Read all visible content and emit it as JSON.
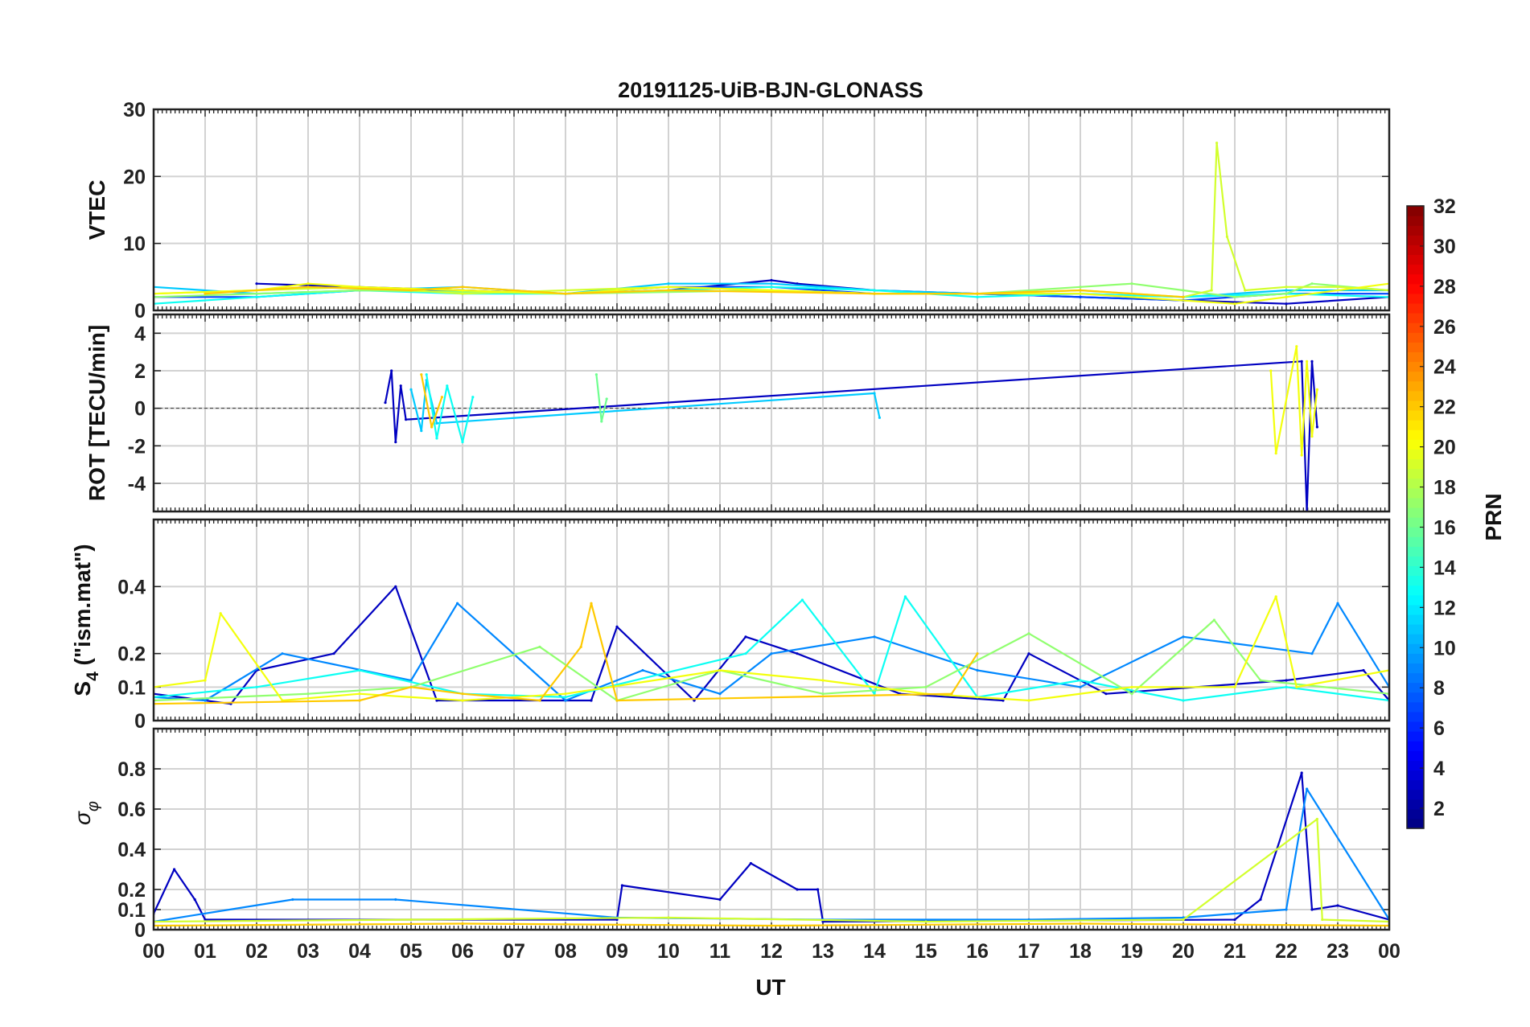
{
  "chart_data": {
    "type": "line",
    "title": "20191125-UiB-BJN-GLONASS",
    "xlabel": "UT",
    "x_unit": "hour",
    "xlim": [
      0,
      24
    ],
    "x_tick_values": [
      0,
      1,
      2,
      3,
      4,
      5,
      6,
      7,
      8,
      9,
      10,
      11,
      12,
      13,
      14,
      15,
      16,
      17,
      18,
      19,
      20,
      21,
      22,
      23,
      24
    ],
    "x_tick_labels": [
      "00",
      "01",
      "02",
      "03",
      "04",
      "05",
      "06",
      "07",
      "08",
      "09",
      "10",
      "11",
      "12",
      "13",
      "14",
      "15",
      "16",
      "17",
      "18",
      "19",
      "20",
      "21",
      "22",
      "23",
      "00"
    ],
    "grid": true,
    "colorbar": {
      "label": "PRN",
      "range": [
        1,
        32
      ],
      "colormap": "jet",
      "tick_labels": [
        "2",
        "4",
        "6",
        "8",
        "10",
        "12",
        "14",
        "16",
        "18",
        "20",
        "22",
        "24",
        "26",
        "28",
        "30",
        "32"
      ]
    },
    "panels": [
      {
        "ylabel": "VTEC",
        "ylim": [
          0,
          30
        ],
        "yticks": [
          "0",
          "10",
          "20",
          "30"
        ],
        "series": [
          {
            "prn": 3,
            "x": [
              2.0,
              4.0,
              6.0,
              8.0,
              10.0,
              12.0,
              12.5,
              14.0,
              16.0,
              18.0,
              20.0,
              22.0,
              24.0
            ],
            "y": [
              4.0,
              3.5,
              3.0,
              2.5,
              3.0,
              4.5,
              4.0,
              3.0,
              2.5,
              2.0,
              1.5,
              1.0,
              2.0
            ]
          },
          {
            "prn": 7,
            "x": [
              0.0,
              2.0,
              4.0,
              6.0,
              8.0,
              10.0,
              12.0,
              14.0,
              16.0,
              18.0,
              20.0,
              22.0,
              24.0
            ],
            "y": [
              2.0,
              2.0,
              3.0,
              3.0,
              2.5,
              3.5,
              3.5,
              2.5,
              2.5,
              2.0,
              1.5,
              2.5,
              2.5
            ]
          },
          {
            "prn": 11,
            "x": [
              0.0,
              2.0,
              4.0,
              6.0,
              8.0,
              10.0,
              12.0,
              14.0,
              16.0,
              18.0,
              20.0,
              22.0,
              24.0
            ],
            "y": [
              3.5,
              2.5,
              3.0,
              3.5,
              2.5,
              4.0,
              4.0,
              3.0,
              2.5,
              2.5,
              2.0,
              3.0,
              3.0
            ]
          },
          {
            "prn": 13,
            "x": [
              0.0,
              2.0,
              4.0,
              6.0,
              8.0,
              10.0,
              12.0,
              14.0,
              16.0,
              18.0,
              20.0,
              22.0,
              24.0
            ],
            "y": [
              1.0,
              2.0,
              3.0,
              2.5,
              2.5,
              3.0,
              3.5,
              3.0,
              2.0,
              2.5,
              2.0,
              2.5,
              2.0
            ]
          },
          {
            "prn": 17,
            "x": [
              0.0,
              4.0,
              8.0,
              12.0,
              14.0,
              16.0,
              18.0,
              19.0,
              20.0,
              21.0,
              22.0,
              22.5,
              24.0
            ],
            "y": [
              2.0,
              3.0,
              2.5,
              3.0,
              2.5,
              2.5,
              3.5,
              4.0,
              3.0,
              2.0,
              2.5,
              4.0,
              3.0
            ]
          },
          {
            "prn": 19,
            "x": [
              0.0,
              2.0,
              4.0,
              6.0,
              8.0,
              10.0,
              12.0,
              14.0,
              16.0,
              18.0,
              20.0,
              20.55,
              20.65,
              20.85,
              21.2,
              22.0,
              23.0,
              24.0
            ],
            "y": [
              2.5,
              3.0,
              3.5,
              2.5,
              3.0,
              3.5,
              3.0,
              2.5,
              2.5,
              3.0,
              2.0,
              3.0,
              25.0,
              11.0,
              3.0,
              3.5,
              3.5,
              3.0
            ]
          },
          {
            "prn": 20,
            "x": [
              0.0,
              2.0,
              3.0,
              4.0,
              6.0,
              8.0,
              10.0,
              12.0,
              14.0,
              16.0,
              18.0,
              21.0,
              22.0,
              24.0
            ],
            "y": [
              2.5,
              3.0,
              4.0,
              3.5,
              3.0,
              2.5,
              3.5,
              3.0,
              2.5,
              2.5,
              2.5,
              1.0,
              2.0,
              4.0
            ]
          },
          {
            "prn": 22,
            "x": [
              1.0,
              3.0,
              5.0,
              6.0,
              8.0,
              10.0,
              14.0,
              16.0,
              18.0,
              20.0
            ],
            "y": [
              2.5,
              3.5,
              3.0,
              3.5,
              2.5,
              3.0,
              2.5,
              2.5,
              3.0,
              2.0
            ]
          }
        ]
      },
      {
        "ylabel": "ROT [TECU/min]",
        "ylim": [
          -5.5,
          5
        ],
        "yticks": [
          "-4",
          "-2",
          "0",
          "2",
          "4"
        ],
        "series": [
          {
            "prn": 3,
            "x": [
              4.5,
              4.62,
              4.7,
              4.8,
              4.9,
              22.3,
              22.4,
              22.5,
              22.6
            ],
            "y": [
              0.3,
              2.0,
              -1.8,
              1.2,
              -0.6,
              2.5,
              -5.5,
              2.5,
              -1.0
            ]
          },
          {
            "prn": 11,
            "x": [
              5.0,
              5.2,
              5.3,
              5.5,
              14.0,
              14.1
            ],
            "y": [
              1.0,
              -1.2,
              1.5,
              -0.8,
              0.8,
              -0.5
            ]
          },
          {
            "prn": 13,
            "x": [
              5.3,
              5.5,
              5.7,
              6.0,
              6.2
            ],
            "y": [
              1.8,
              -1.6,
              1.2,
              -1.8,
              0.6
            ]
          },
          {
            "prn": 16,
            "x": [
              8.6,
              8.7,
              8.8
            ],
            "y": [
              1.8,
              -0.7,
              0.5
            ]
          },
          {
            "prn": 20,
            "x": [
              21.7,
              21.8,
              22.2,
              22.3,
              22.4,
              22.5,
              22.6
            ],
            "y": [
              2.0,
              -2.4,
              3.3,
              -2.5,
              2.5,
              -1.5,
              1.0
            ]
          },
          {
            "prn": 22,
            "x": [
              5.2,
              5.4,
              5.6
            ],
            "y": [
              1.8,
              -1.0,
              0.6
            ]
          }
        ]
      },
      {
        "ylabel": "S4 (\"ism.mat\")",
        "ylim": [
          0,
          0.6
        ],
        "yticks": [
          "0",
          "0.1",
          "0.2",
          "0.4"
        ],
        "series": [
          {
            "prn": 3,
            "x": [
              0.0,
              1.5,
              2.0,
              3.5,
              4.7,
              5.5,
              8.5,
              9.0,
              10.5,
              11.5,
              12.5,
              14.5,
              16.5,
              17.0,
              18.5,
              22.0,
              23.5,
              24.0
            ],
            "y": [
              0.08,
              0.05,
              0.15,
              0.2,
              0.4,
              0.06,
              0.06,
              0.28,
              0.06,
              0.25,
              0.2,
              0.08,
              0.06,
              0.2,
              0.08,
              0.12,
              0.15,
              0.06
            ]
          },
          {
            "prn": 9,
            "x": [
              0.0,
              1.0,
              2.5,
              5.0,
              5.9,
              8.0,
              9.5,
              11.0,
              12.0,
              14.0,
              16.0,
              18.0,
              20.0,
              22.5,
              23.0,
              24.0
            ],
            "y": [
              0.07,
              0.06,
              0.2,
              0.12,
              0.35,
              0.06,
              0.15,
              0.08,
              0.2,
              0.25,
              0.15,
              0.1,
              0.25,
              0.2,
              0.35,
              0.1
            ]
          },
          {
            "prn": 13,
            "x": [
              0.0,
              2.0,
              4.0,
              6.0,
              8.0,
              11.5,
              12.6,
              14.0,
              14.6,
              16.0,
              18.0,
              20.0,
              22.0,
              24.0
            ],
            "y": [
              0.07,
              0.1,
              0.15,
              0.08,
              0.07,
              0.2,
              0.36,
              0.08,
              0.37,
              0.07,
              0.12,
              0.06,
              0.1,
              0.06
            ]
          },
          {
            "prn": 17,
            "x": [
              0.0,
              3.0,
              5.0,
              7.5,
              9.0,
              11.0,
              13.0,
              15.0,
              17.0,
              19.0,
              20.6,
              21.5,
              24.0
            ],
            "y": [
              0.06,
              0.08,
              0.1,
              0.22,
              0.06,
              0.15,
              0.08,
              0.1,
              0.26,
              0.08,
              0.3,
              0.12,
              0.08
            ]
          },
          {
            "prn": 20,
            "x": [
              0.0,
              1.0,
              1.3,
              2.5,
              4.0,
              6.0,
              8.0,
              11.0,
              13.0,
              15.0,
              17.0,
              19.0,
              21.0,
              21.8,
              22.2,
              24.0
            ],
            "y": [
              0.1,
              0.12,
              0.32,
              0.06,
              0.08,
              0.06,
              0.08,
              0.15,
              0.12,
              0.08,
              0.06,
              0.1,
              0.1,
              0.37,
              0.1,
              0.15
            ]
          },
          {
            "prn": 22,
            "x": [
              0.0,
              4.0,
              5.0,
              6.0,
              7.5,
              8.3,
              8.5,
              9.0,
              15.5,
              16.0
            ],
            "y": [
              0.05,
              0.06,
              0.1,
              0.08,
              0.06,
              0.22,
              0.35,
              0.06,
              0.08,
              0.2
            ]
          }
        ]
      },
      {
        "ylabel": "σφ",
        "ylim": [
          0,
          1
        ],
        "yticks": [
          "0",
          "0.1",
          "0.2",
          "0.4",
          "0.6",
          "0.8"
        ],
        "series": [
          {
            "prn": 3,
            "x": [
              0.0,
              0.4,
              0.8,
              1.0,
              9.0,
              9.1,
              11.0,
              11.6,
              12.5,
              12.9,
              13.0,
              21.0,
              21.5,
              22.3,
              22.5,
              23.0,
              24.0
            ],
            "y": [
              0.08,
              0.3,
              0.15,
              0.05,
              0.05,
              0.22,
              0.15,
              0.33,
              0.2,
              0.2,
              0.04,
              0.05,
              0.15,
              0.78,
              0.1,
              0.12,
              0.05
            ]
          },
          {
            "prn": 9,
            "x": [
              0.0,
              2.7,
              4.7,
              9.0,
              13.0,
              17.0,
              20.0,
              22.0,
              22.4,
              24.0
            ],
            "y": [
              0.04,
              0.15,
              0.15,
              0.06,
              0.05,
              0.05,
              0.06,
              0.1,
              0.7,
              0.05
            ]
          },
          {
            "prn": 19,
            "x": [
              0.0,
              5.0,
              10.0,
              15.0,
              20.0,
              22.6,
              22.7,
              24.0
            ],
            "y": [
              0.04,
              0.05,
              0.06,
              0.04,
              0.05,
              0.55,
              0.05,
              0.04
            ]
          },
          {
            "prn": 22,
            "x": [
              0.0,
              6.0,
              12.0,
              18.0,
              24.0
            ],
            "y": [
              0.02,
              0.03,
              0.02,
              0.03,
              0.02
            ]
          }
        ]
      }
    ]
  }
}
